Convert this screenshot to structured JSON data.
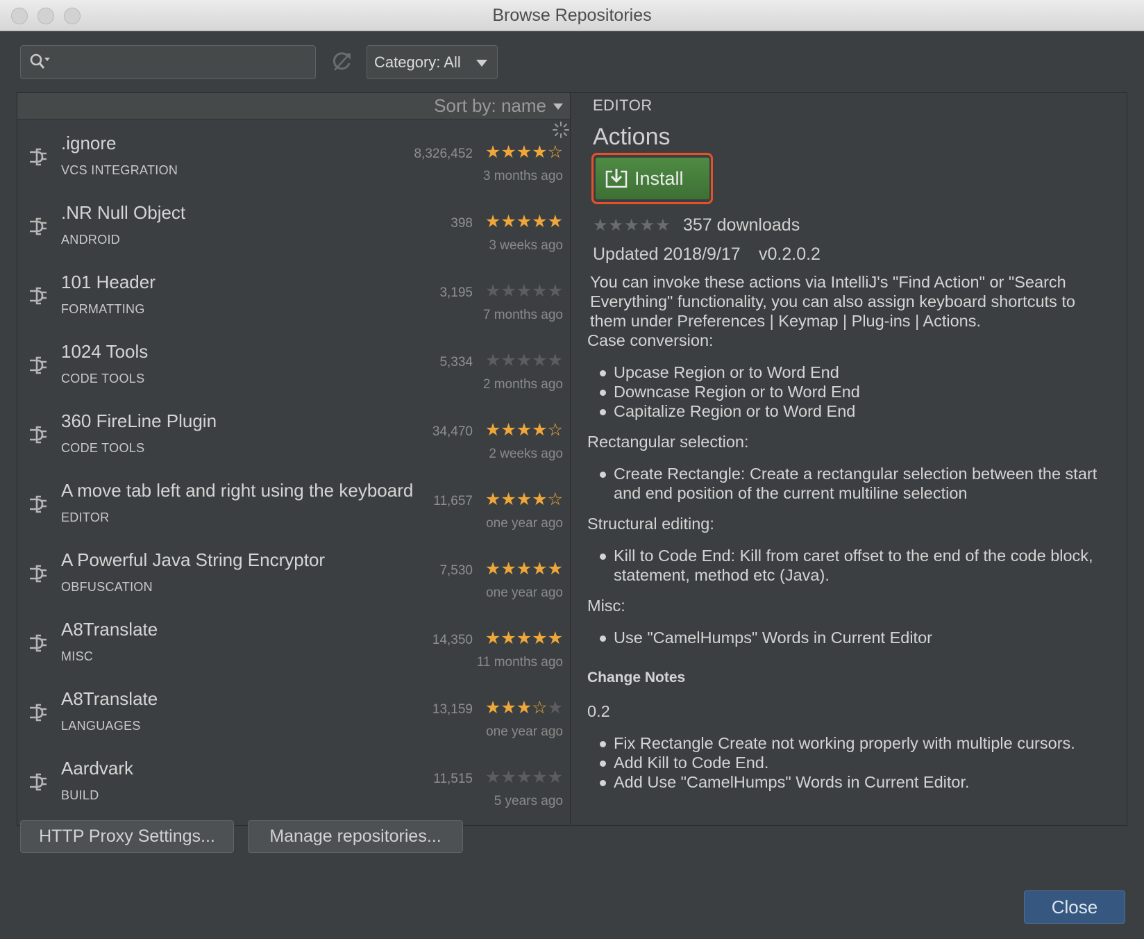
{
  "window": {
    "title": "Browse Repositories"
  },
  "toolbar": {
    "search_value": "",
    "category_label": "Category: All"
  },
  "list": {
    "sort_label": "Sort by: name",
    "items": [
      {
        "name": ".ignore",
        "category": "VCS INTEGRATION",
        "downloads": "8,326,452",
        "rating": 4.5,
        "stars": "★★★★☆",
        "updated": "3 months ago"
      },
      {
        "name": ".NR Null Object",
        "category": "ANDROID",
        "downloads": "398",
        "rating": 5,
        "stars": "★★★★★",
        "updated": "3 weeks ago"
      },
      {
        "name": "101 Header",
        "category": "FORMATTING",
        "downloads": "3,195",
        "rating": 0,
        "stars": "★★★★★",
        "updated": "7 months ago"
      },
      {
        "name": "1024 Tools",
        "category": "CODE TOOLS",
        "downloads": "5,334",
        "rating": 0,
        "stars": "★★★★★",
        "updated": "2 months ago"
      },
      {
        "name": "360 FireLine Plugin",
        "category": "CODE TOOLS",
        "downloads": "34,470",
        "rating": 4.5,
        "stars": "★★★★☆",
        "updated": "2 weeks ago"
      },
      {
        "name": "A move tab left and right using the keyboard",
        "category": "EDITOR",
        "downloads": "11,657",
        "rating": 4.5,
        "stars": "★★★★☆",
        "updated": "one year ago"
      },
      {
        "name": "A Powerful Java String Encryptor",
        "category": "OBFUSCATION",
        "downloads": "7,530",
        "rating": 5,
        "stars": "★★★★★",
        "updated": "one year ago"
      },
      {
        "name": "A8Translate",
        "category": "MISC",
        "downloads": "14,350",
        "rating": 5,
        "stars": "★★★★★",
        "updated": "11 months ago"
      },
      {
        "name": "A8Translate",
        "category": "LANGUAGES",
        "downloads": "13,159",
        "rating": 3.5,
        "stars": "★★★☆★",
        "updated": "one year ago"
      },
      {
        "name": "Aardvark",
        "category": "BUILD",
        "downloads": "11,515",
        "rating": 0,
        "stars": "★★★★★",
        "updated": "5 years ago"
      }
    ]
  },
  "detail": {
    "category": "EDITOR",
    "name": "Actions",
    "install_label": "Install",
    "rating_stars": "★★★★★",
    "downloads": "357 downloads",
    "updated": "Updated 2018/9/17",
    "version": "v0.2.0.2",
    "intro": "You can invoke these actions via IntelliJ's \"Find Action\" or \"Search Everything\" functionality, you can also assign keyboard shortcuts to them under Preferences | Keymap | Plug-ins | Actions.",
    "sections": [
      {
        "heading": "Case conversion:",
        "items": [
          "Upcase Region or to Word End",
          "Downcase Region or to Word End",
          "Capitalize Region or to Word End"
        ]
      },
      {
        "heading": "Rectangular selection:",
        "items": [
          "Create Rectangle: Create a rectangular selection between the start and end position of the current multiline selection"
        ]
      },
      {
        "heading": "Structural editing:",
        "items": [
          "Kill to Code End: Kill from caret offset to the end of the code block, statement, method etc (Java)."
        ]
      },
      {
        "heading": "Misc:",
        "items": [
          "Use \"CamelHumps\" Words in Current Editor"
        ]
      }
    ],
    "change_notes_heading": "Change Notes",
    "change_notes_version": "0.2",
    "change_notes": [
      "Fix Rectangle Create not working properly with multiple cursors.",
      "Add Kill to Code End.",
      "Add Use \"CamelHumps\" Words in Current Editor."
    ]
  },
  "footer": {
    "proxy_label": "HTTP Proxy Settings...",
    "repos_label": "Manage repositories...",
    "close_label": "Close"
  },
  "colors": {
    "star_on": "#f0a73a",
    "star_off": "#5b5d5f",
    "install_green": "#4e8b43",
    "highlight": "#e5522a",
    "close_blue": "#365880"
  }
}
